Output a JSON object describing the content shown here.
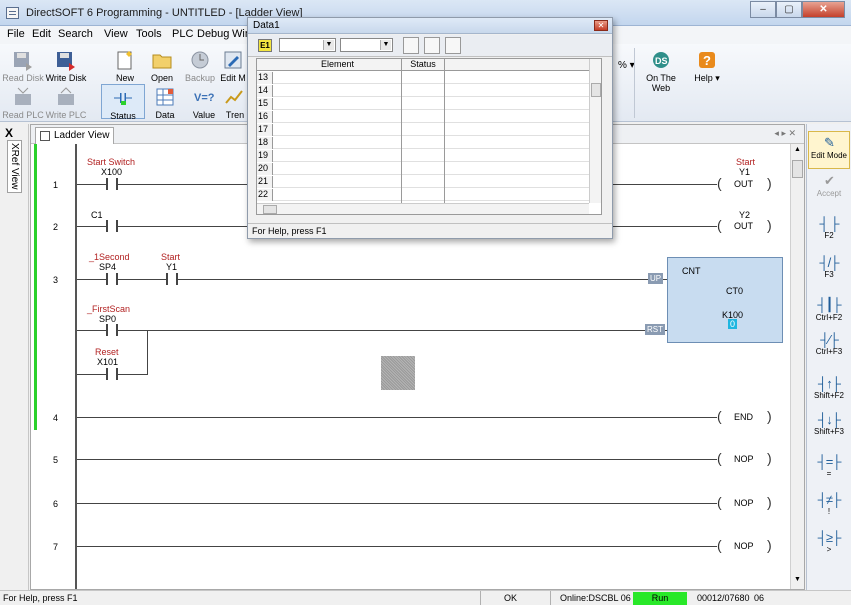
{
  "app": {
    "title": "DirectSOFT 6 Programming - UNTITLED - [Ladder View]"
  },
  "menu": [
    "File",
    "Edit",
    "Search",
    "View",
    "Tools",
    "PLC",
    "Debug",
    "Wind"
  ],
  "toolbar": {
    "row1": [
      {
        "label": "Read Disk",
        "icon": "read-disk-icon",
        "dim": true
      },
      {
        "label": "Write Disk",
        "icon": "write-disk-icon",
        "dim": false
      },
      {
        "label": "New",
        "icon": "new-icon",
        "dim": false
      },
      {
        "label": "Open",
        "icon": "open-folder-icon",
        "dim": false
      },
      {
        "label": "Backup",
        "icon": "backup-icon",
        "dim": true
      },
      {
        "label": "Edit M",
        "icon": "edit-mode-icon",
        "dim": false
      }
    ],
    "row2": [
      {
        "label": "Read PLC",
        "icon": "read-plc-icon",
        "dim": true
      },
      {
        "label": "Write PLC",
        "icon": "write-plc-icon",
        "dim": true
      },
      {
        "label": "Status",
        "icon": "status-icon",
        "dim": false
      },
      {
        "label": "Data",
        "icon": "data-icon",
        "dim": false
      },
      {
        "label": "Value",
        "icon": "value-icon",
        "dim": false
      },
      {
        "label": "Tren",
        "icon": "trend-icon",
        "dim": false
      }
    ],
    "zoom_fragment": "% ▾",
    "web_label": "On The Web",
    "help_label": "Help"
  },
  "left_panel": {
    "close": "X",
    "label": "XRef View"
  },
  "ladder": {
    "tab": "Ladder View",
    "nav": "◂ ▸ ✕",
    "rungs": [
      "1",
      "2",
      "3",
      "4",
      "5",
      "6",
      "7"
    ],
    "labels": {
      "start_switch": "Start Switch",
      "x100": "X100",
      "c1": "C1",
      "one_second": "_1Second",
      "sp4": "SP4",
      "start_nick": "Start",
      "y1_contact": "Y1",
      "first_scan": "_FirstScan",
      "sp0": "SP0",
      "reset": "Reset",
      "x101": "X101"
    },
    "coils": [
      {
        "nick": "Start",
        "addr": "Y1",
        "op": "OUT"
      },
      {
        "nick": "",
        "addr": "Y2",
        "op": "OUT"
      },
      {
        "nick": "",
        "addr": "",
        "op": "END"
      },
      {
        "nick": "",
        "addr": "",
        "op": "NOP"
      },
      {
        "nick": "",
        "addr": "",
        "op": "NOP"
      },
      {
        "nick": "",
        "addr": "",
        "op": "NOP"
      }
    ],
    "counter": {
      "name": "CNT",
      "reg": "CT0",
      "preset": "K100",
      "value": "0",
      "up": "UP",
      "rst": "RST"
    }
  },
  "right_panel": [
    {
      "label": "Edit Mode",
      "sym": "✎",
      "state": "sel"
    },
    {
      "label": "Accept",
      "sym": "✔",
      "state": "dim"
    },
    {
      "label": "F2",
      "sym": "┤ ├",
      "state": ""
    },
    {
      "label": "F3",
      "sym": "┤/├",
      "state": ""
    },
    {
      "label": "Ctrl+F2",
      "sym": "┤┃├",
      "state": ""
    },
    {
      "label": "Ctrl+F3",
      "sym": "┤⁄├",
      "state": ""
    },
    {
      "label": "Shift+F2",
      "sym": "┤↑├",
      "state": ""
    },
    {
      "label": "Shift+F3",
      "sym": "┤↓├",
      "state": ""
    },
    {
      "label": "=",
      "sym": "┤=├",
      "state": ""
    },
    {
      "label": "!",
      "sym": "┤≠├",
      "state": ""
    },
    {
      "label": ">",
      "sym": "┤≥├",
      "state": ""
    }
  ],
  "data_window": {
    "title": "Data1",
    "e1": "E1",
    "col_element": "Element",
    "col_status": "Status",
    "rows": [
      "13",
      "14",
      "15",
      "16",
      "17",
      "18",
      "19",
      "20",
      "21",
      "22"
    ],
    "status": "For Help, press F1"
  },
  "statusbar": {
    "help": "For Help, press F1",
    "ok": "OK",
    "online": "Online:DSCBL 06",
    "run": "Run",
    "mem": "00012/07680",
    "num": "06"
  },
  "colors": {
    "run_green": "#29e829",
    "nickname_red": "#b22222",
    "counter_fill": "#c8dcf0"
  }
}
